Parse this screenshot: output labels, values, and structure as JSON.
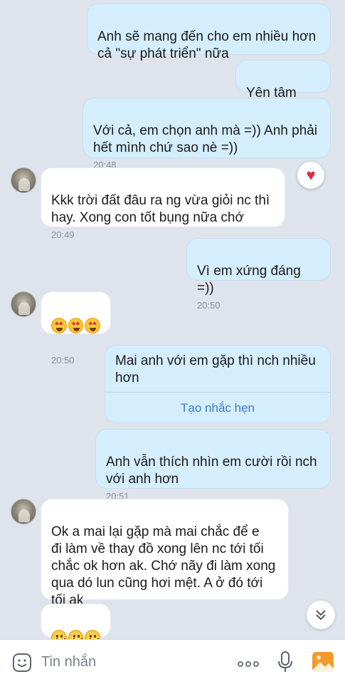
{
  "messages": [
    {
      "id": "m1",
      "direction": "out",
      "text": "Anh sẽ mang đến cho em nhiều hơn\ncả \"sự phát triển\" nữa"
    },
    {
      "id": "m2",
      "direction": "out",
      "text": "Yên tâm nha"
    },
    {
      "id": "m3",
      "direction": "out",
      "text": "Với cả, em chọn anh mà =)) Anh phải\nhết mình chứ sao nè =))",
      "time": "20:48"
    },
    {
      "id": "m4",
      "direction": "in",
      "text": "Kkk trời đất đâu ra ng vừa giỏi nc thì\nhay. Xong con tốt bụng nữa chớ",
      "time": "20:49",
      "reaction": "heart"
    },
    {
      "id": "m5",
      "direction": "out",
      "text": "Vì em xứng đáng =))",
      "time": "20:50"
    },
    {
      "id": "m6",
      "direction": "in",
      "emoji": "star-struck x3",
      "time": "20:50"
    },
    {
      "id": "m7",
      "direction": "out",
      "text": "Mai anh với em gặp thì nch nhiều\nhơn",
      "action_label": "Tạo nhắc hẹn"
    },
    {
      "id": "m8",
      "direction": "out",
      "text": "Anh vẫn thích nhìn em cười rồi nch\nvới anh hơn",
      "time": "20:51"
    },
    {
      "id": "m9",
      "direction": "in",
      "text": "Ok a mai lại gặp mà mai chắc để e\nđi làm về thay đồ xong lên nc tới tối\nchắc ok hơn ak. Chớ nãy đi làm xong\nqua dó lun cũng hơi mệt. A ở đó tới\ntối ak"
    },
    {
      "id": "m10",
      "direction": "in",
      "emoji": "smiling x3"
    }
  ],
  "composer": {
    "placeholder": "Tin nhắn",
    "icons": [
      "sticker-icon",
      "more-icon",
      "microphone-icon",
      "photo-icon"
    ]
  },
  "colors": {
    "background": "#dfe4ec",
    "outgoing_bubble": "#d5eefe",
    "incoming_bubble": "#ffffff",
    "link": "#3a7dc9",
    "heart": "#e5273d"
  }
}
